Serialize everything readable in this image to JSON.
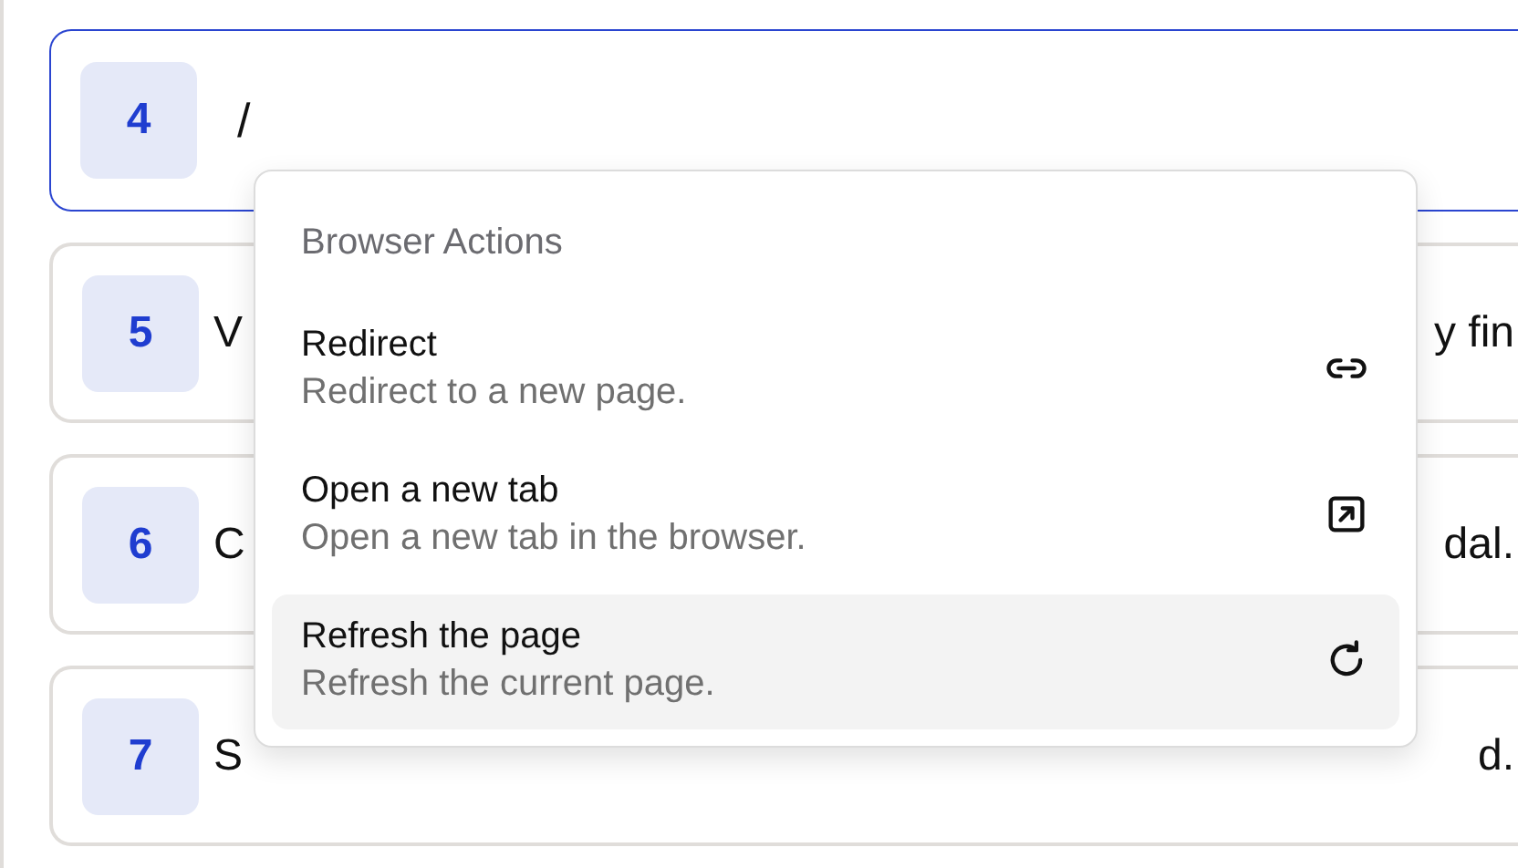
{
  "steps": [
    {
      "number": "4",
      "value": "/",
      "focused": true
    },
    {
      "number": "5",
      "text_start": "V",
      "text_end": "y fin",
      "focused": false
    },
    {
      "number": "6",
      "text_start": "C",
      "text_end": "dal.",
      "focused": false
    },
    {
      "number": "7",
      "text_start": "S",
      "text_end": "d.",
      "focused": false
    }
  ],
  "menu": {
    "heading": "Browser Actions",
    "items": [
      {
        "kind": "link",
        "title": "Redirect",
        "description": "Redirect to a new page.",
        "selected": false
      },
      {
        "kind": "new-tab",
        "title": "Open a new tab",
        "description": "Open a new tab in the browser.",
        "selected": false
      },
      {
        "kind": "refresh",
        "title": "Refresh the page",
        "description": "Refresh the current page.",
        "selected": true
      }
    ]
  }
}
